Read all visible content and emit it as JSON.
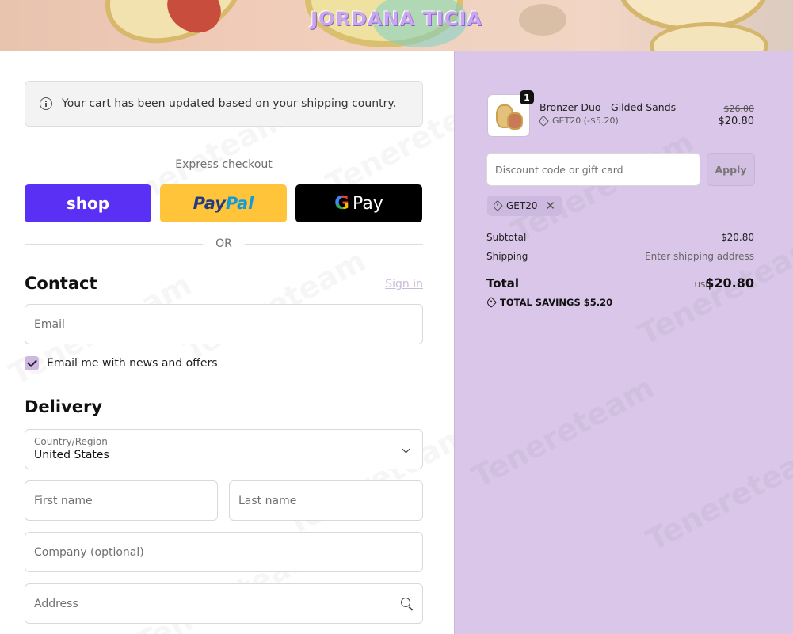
{
  "brand": {
    "name": "JORDANA TICIA"
  },
  "notice": {
    "text": "Your cart has been updated based on your shipping country."
  },
  "express": {
    "title": "Express checkout",
    "shop_label": "shop",
    "paypal_part1": "Pay",
    "paypal_part2": "Pal",
    "gpay_g": "G",
    "gpay_label": "Pay",
    "or": "OR"
  },
  "contact": {
    "title": "Contact",
    "signin": "Sign in",
    "email_placeholder": "Email",
    "newsletter_label": "Email me with news and offers",
    "newsletter_checked": true
  },
  "delivery": {
    "title": "Delivery",
    "country_label": "Country/Region",
    "country_value": "United States",
    "first_name_placeholder": "First name",
    "last_name_placeholder": "Last name",
    "company_placeholder": "Company (optional)",
    "address_placeholder": "Address"
  },
  "summary": {
    "product": {
      "quantity": "1",
      "name": "Bronzer Duo - Gilded Sands",
      "discount": "GET20 (-$5.20)",
      "price_original": "$26.00",
      "price_final": "$20.80"
    },
    "discount_placeholder": "Discount code or gift card",
    "apply_label": "Apply",
    "applied_code": "GET20",
    "subtotal_label": "Subtotal",
    "subtotal_value": "$20.80",
    "shipping_label": "Shipping",
    "shipping_value": "Enter shipping address",
    "total_label": "Total",
    "total_currency": "USD",
    "total_value": "$20.80",
    "savings_text": "TOTAL SAVINGS  $5.20"
  },
  "watermark": "Tenereteam",
  "colors": {
    "shop": "#5a31f4",
    "paypal": "#ffc439",
    "gpay": "#000000",
    "summary_bg": "#d9c6e8",
    "checkbox": "#cfb9e3"
  }
}
